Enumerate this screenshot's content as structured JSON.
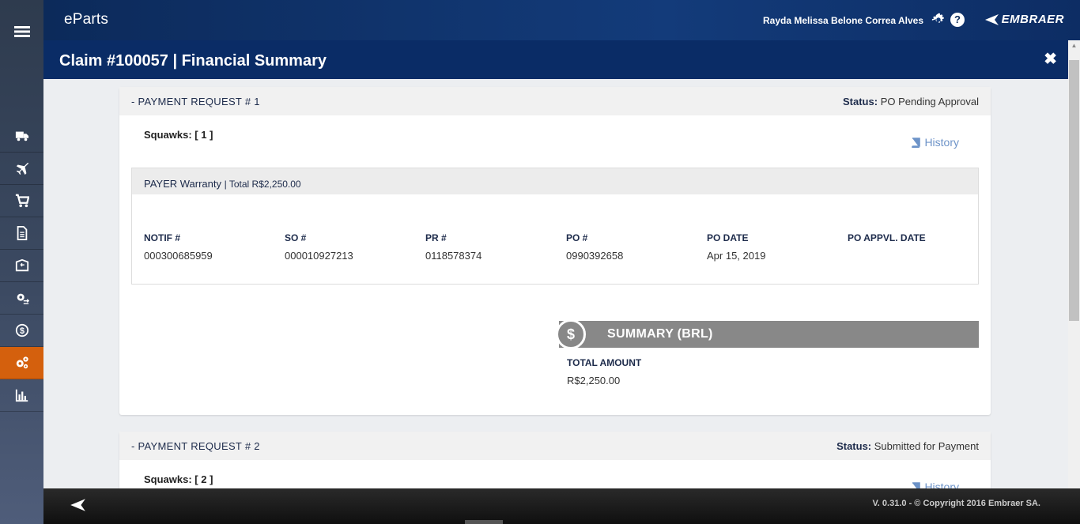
{
  "app": {
    "title": "eParts",
    "user_name": "Rayda Melissa Belone Correa Alves",
    "brand": "EMBRAER",
    "help_label": "?"
  },
  "sidebar": {
    "items": [
      {
        "icon": "truck-icon"
      },
      {
        "icon": "airplane-icon"
      },
      {
        "icon": "cart-icon"
      },
      {
        "icon": "document-icon"
      },
      {
        "icon": "package-return-icon"
      },
      {
        "icon": "settings-transfer-icon"
      },
      {
        "icon": "dollar-circle-icon"
      },
      {
        "icon": "gears-icon",
        "active": true
      },
      {
        "icon": "bar-chart-icon"
      }
    ],
    "active_color": "#d4600d"
  },
  "header": {
    "title": "Claim #100057 | Financial Summary",
    "close_label": "✖"
  },
  "payment_requests": [
    {
      "title": "- PAYMENT REQUEST # 1",
      "status_label": "Status:",
      "status_value": "PO Pending Approval",
      "squawks": "Squawks: [ 1 ]",
      "history_label": "History",
      "payer": {
        "label": "PAYER Warranty",
        "total": "| Total R$2,250.00"
      },
      "fields": [
        {
          "label": "NOTIF #",
          "value": "000300685959"
        },
        {
          "label": "SO #",
          "value": "000010927213"
        },
        {
          "label": "PR #",
          "value": "0118578374"
        },
        {
          "label": "PO #",
          "value": "0990392658"
        },
        {
          "label": "PO DATE",
          "value": "Apr 15, 2019"
        },
        {
          "label": "PO APPVL. DATE",
          "value": ""
        }
      ],
      "summary": {
        "title": "SUMMARY (BRL)",
        "icon_symbol": "$",
        "total_label": "TOTAL AMOUNT",
        "total_value": "R$2,250.00"
      }
    },
    {
      "title": "- PAYMENT REQUEST # 2",
      "status_label": "Status:",
      "status_value": "Submitted for Payment",
      "squawks": "Squawks: [ 2 ]",
      "history_label": "History"
    }
  ],
  "footer": {
    "text": "V. 0.31.0 - © Copyright 2016 Embraer SA."
  }
}
